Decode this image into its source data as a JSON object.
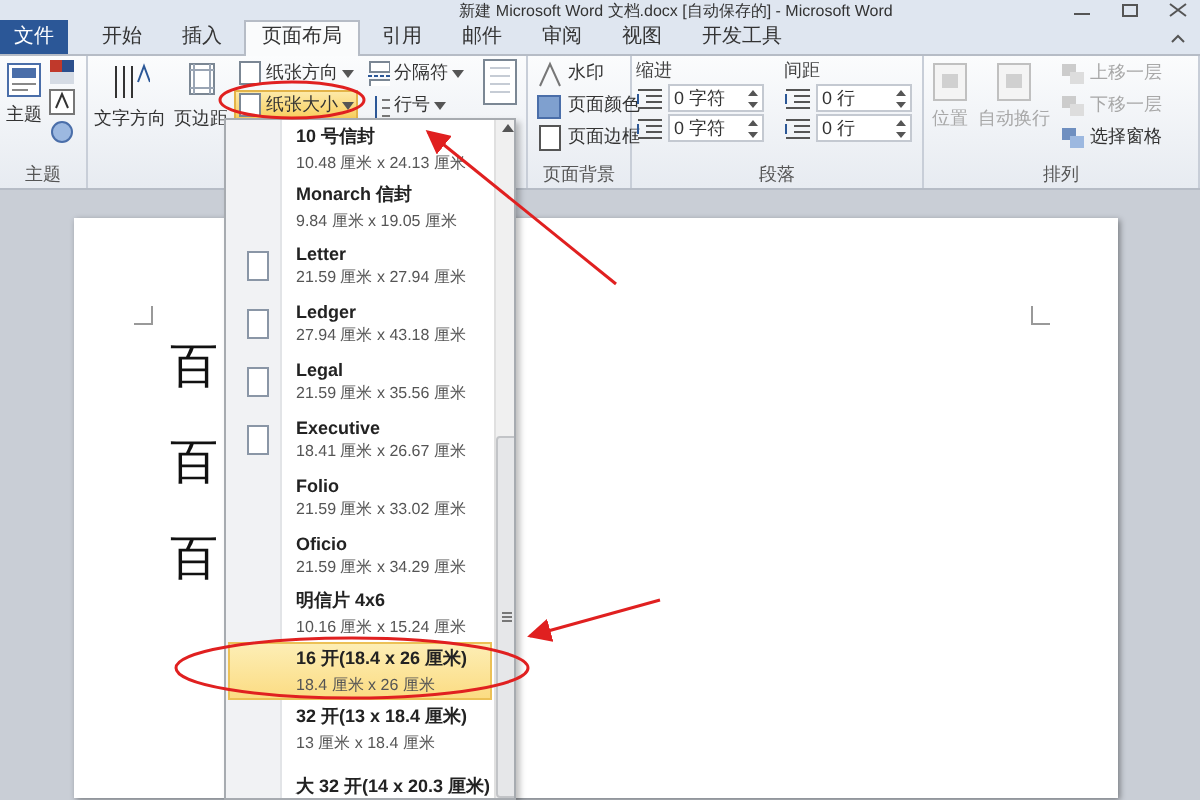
{
  "window": {
    "title": "新建 Microsoft Word 文档.docx [自动保存的] - Microsoft Word"
  },
  "tabs": [
    {
      "label": "文件",
      "selected": false,
      "kind": "file"
    },
    {
      "label": "开始",
      "selected": false,
      "kind": "tab"
    },
    {
      "label": "插入",
      "selected": false,
      "kind": "tab"
    },
    {
      "label": "页面布局",
      "selected": true,
      "kind": "tab"
    },
    {
      "label": "引用",
      "selected": false,
      "kind": "tab"
    },
    {
      "label": "邮件",
      "selected": false,
      "kind": "tab"
    },
    {
      "label": "审阅",
      "selected": false,
      "kind": "tab"
    },
    {
      "label": "视图",
      "selected": false,
      "kind": "tab"
    },
    {
      "label": "开发工具",
      "selected": false,
      "kind": "tab"
    }
  ],
  "ribbon": {
    "themes": {
      "label": "主题",
      "button": "主题"
    },
    "page_setup": {
      "large_buttons": [
        "文字方向",
        "页边距"
      ],
      "small_buttons": [
        {
          "label": "纸张方向",
          "selected": false
        },
        {
          "label": "纸张大小",
          "selected": true
        },
        {
          "label": "分隔符",
          "selected": false
        },
        {
          "label": "行号",
          "selected": false
        }
      ]
    },
    "page_background": {
      "label": "页面背景",
      "buttons": [
        "水印",
        "页面颜色",
        "页面边框"
      ]
    },
    "paragraph": {
      "label": "段落",
      "indent": {
        "heading": "缩进",
        "fields": [
          "0 字符",
          "0 字符"
        ]
      },
      "spacing": {
        "heading": "间距",
        "fields": [
          "0 行",
          "0 行"
        ]
      }
    },
    "arrange": {
      "label": "排列",
      "large_buttons": [
        {
          "label": "位置",
          "disabled": true
        },
        {
          "label": "自动换行",
          "disabled": true
        }
      ],
      "small_buttons": [
        {
          "label": "上移一层",
          "disabled": true
        },
        {
          "label": "下移一层",
          "disabled": true
        },
        {
          "label": "选择窗格",
          "disabled": false
        }
      ]
    }
  },
  "document": {
    "lines": [
      "百",
      "百",
      "百"
    ]
  },
  "paper_menu": {
    "items": [
      {
        "name": "10 号信封",
        "size": "10.48 厘米 x 24.13 厘米",
        "icon": false,
        "selected": false
      },
      {
        "name": "Monarch 信封",
        "size": "9.84 厘米 x 19.05 厘米",
        "icon": false,
        "selected": false
      },
      {
        "name": "Letter",
        "size": "21.59 厘米 x 27.94 厘米",
        "icon": true,
        "selected": false
      },
      {
        "name": "Ledger",
        "size": "27.94 厘米 x 43.18 厘米",
        "icon": true,
        "selected": false
      },
      {
        "name": "Legal",
        "size": "21.59 厘米 x 35.56 厘米",
        "icon": true,
        "selected": false
      },
      {
        "name": "Executive",
        "size": "18.41 厘米 x 26.67 厘米",
        "icon": true,
        "selected": false
      },
      {
        "name": "Folio",
        "size": "21.59 厘米 x 33.02 厘米",
        "icon": false,
        "selected": false
      },
      {
        "name": "Oficio",
        "size": "21.59 厘米 x 34.29 厘米",
        "icon": false,
        "selected": false
      },
      {
        "name": "明信片 4x6",
        "size": "10.16 厘米 x 15.24 厘米",
        "icon": false,
        "selected": false
      },
      {
        "name": "16 开(18.4 x 26 厘米)",
        "size": "18.4 厘米 x 26 厘米",
        "icon": false,
        "selected": true
      },
      {
        "name": "32 开(13 x 18.4 厘米)",
        "size": "13 厘米 x 18.4 厘米",
        "icon": false,
        "selected": false
      },
      {
        "name": "大 32 开(14 x 20.3 厘米)",
        "icon": false,
        "selected": false
      }
    ]
  }
}
